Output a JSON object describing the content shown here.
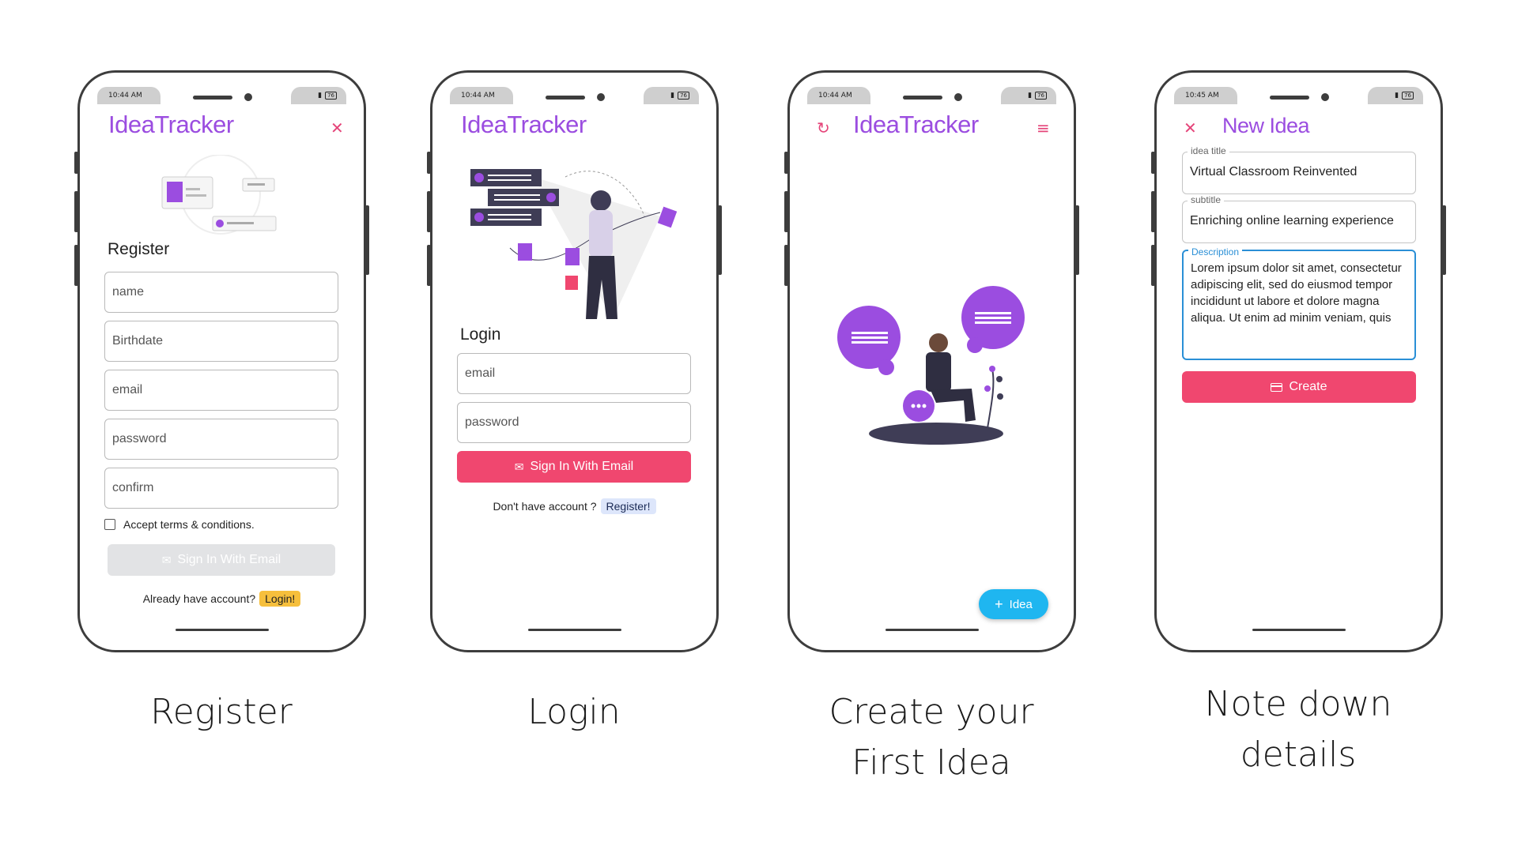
{
  "status_bar": {
    "time_1": "10:44 AM",
    "time_2": "10:44 AM",
    "time_3": "10:44 AM",
    "time_4": "10:45 AM",
    "battery": "76"
  },
  "app": {
    "name": "IdeaTracker"
  },
  "register": {
    "heading": "Register",
    "fields": {
      "name": "name",
      "birthdate": "Birthdate",
      "email": "email",
      "password": "password",
      "confirm": "confirm"
    },
    "terms_label": "Accept terms & conditions.",
    "submit_label": "Sign In With Email",
    "have_account": "Already have account?",
    "login_link": "Login!"
  },
  "login": {
    "heading": "Login",
    "fields": {
      "email": "email",
      "password": "password"
    },
    "submit_label": "Sign In With Email",
    "no_account": "Don't have account ?",
    "register_link": "Register!"
  },
  "home": {
    "fab_label": "Idea"
  },
  "new_idea": {
    "title": "New Idea",
    "idea_title_legend": "idea title",
    "idea_title_value": "Virtual Classroom Reinvented",
    "subtitle_legend": "subtitle",
    "subtitle_value": "Enriching online learning experience",
    "description_legend": "Description",
    "description_value": "Lorem ipsum dolor sit amet, consectetur adipiscing elit, sed do eiusmod tempor incididunt ut labore et dolore magna aliqua. Ut enim ad minim veniam, quis",
    "create_label": "Create"
  },
  "captions": {
    "c1": "Register",
    "c2": "Login",
    "c3_line1": "Create your",
    "c3_line2": "First Idea",
    "c4_line1": "Note down",
    "c4_line2": "details"
  },
  "colors": {
    "brand_purple": "#9b4de0",
    "accent_pink": "#f0476f",
    "fab_blue": "#1fb6f0",
    "disabled_gray": "#e2e3e5",
    "login_chip_yellow": "#f6bf3c",
    "register_chip_blue": "#dde6fb"
  }
}
